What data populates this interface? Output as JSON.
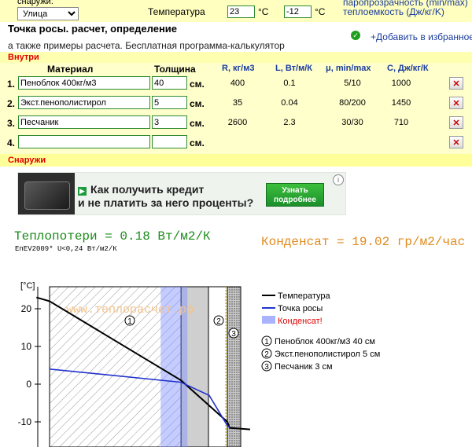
{
  "top": {
    "outside_label": "снаружи:",
    "outside_select": "Улица",
    "temp_label": "Температура",
    "temp_inside": "23",
    "temp_outside": "-12",
    "deg_unit": "°C",
    "right_line1": "паропрозрачность (min/max)",
    "right_line2": "теплоемкость (Дж/кг/K)"
  },
  "heading": {
    "title": "Точка росы. расчет, определение",
    "subtitle": "а также примеры расчета. Бесплатная программа-калькулятор",
    "add_fav": "+Добавить в избранное"
  },
  "inside_label": "Внутри",
  "outside_label2": "Снаружи",
  "table": {
    "headers": [
      "Материал",
      "Толщина",
      "R, кг/м3",
      "L, Вт/м/К",
      "μ, min/max",
      "C, Дж/кг/К"
    ],
    "unit": "см.",
    "rows": [
      {
        "num": "1.",
        "material": "Пеноблок 400кг/м3",
        "thickness": "40",
        "r": "400",
        "l": "0.1",
        "mu": "5/10",
        "c": "1000"
      },
      {
        "num": "2.",
        "material": "Экст.пенополистирол",
        "thickness": "5",
        "r": "35",
        "l": "0.04",
        "mu": "80/200",
        "c": "1450"
      },
      {
        "num": "3.",
        "material": "Песчаник",
        "thickness": "3",
        "r": "2600",
        "l": "2.3",
        "mu": "30/30",
        "c": "710"
      },
      {
        "num": "4.",
        "material": "",
        "thickness": "",
        "r": "",
        "l": "",
        "mu": "",
        "c": ""
      }
    ]
  },
  "ad": {
    "line1": "Как получить кредит",
    "line2": "и не платить за него проценты?",
    "button_line1": "Узнать",
    "button_line2": "подробнее",
    "info": "i"
  },
  "results": {
    "heat_loss": "Теплопотери = 0.18 Вт/м2/К",
    "norm": "EnEV2009* U<0,24 Вт/м2/К",
    "condensate": "Конденсат = 19.02 гр/м2/час"
  },
  "chart_data": {
    "type": "line",
    "y_axis_unit": "[°C]",
    "watermark": "www.теплорасчет.рф",
    "ylim": [
      -13,
      25
    ],
    "yticks": [
      20,
      10,
      0,
      -10
    ],
    "x_layers_cm": [
      {
        "label": "1",
        "from": 0,
        "to": 40
      },
      {
        "label": "2",
        "from": 40,
        "to": 45
      },
      {
        "label": "3",
        "from": 45,
        "to": 48
      }
    ],
    "condensate_zone_cm": [
      33.8,
      40
    ],
    "series": [
      {
        "name": "Температура",
        "color": "#000000",
        "x": [
          -4,
          0,
          40,
          45,
          48,
          51
        ],
        "y": [
          23,
          22,
          1,
          -10,
          -11.6,
          -12
        ]
      },
      {
        "name": "Точка росы",
        "color": "#2233cc",
        "x": [
          0,
          40,
          43.5,
          45,
          48
        ],
        "y": [
          4,
          0.5,
          -3,
          -11,
          -11.5
        ]
      }
    ],
    "legend": [
      "Температура",
      "Точка росы",
      "Конденсат!"
    ],
    "layer_legend": [
      {
        "num": "1",
        "text": "Пеноблок 400кг/м3 40 см"
      },
      {
        "num": "2",
        "text": "Экст.пенополистирол 5 см"
      },
      {
        "num": "3",
        "text": "Песчаник 3 см"
      }
    ]
  }
}
